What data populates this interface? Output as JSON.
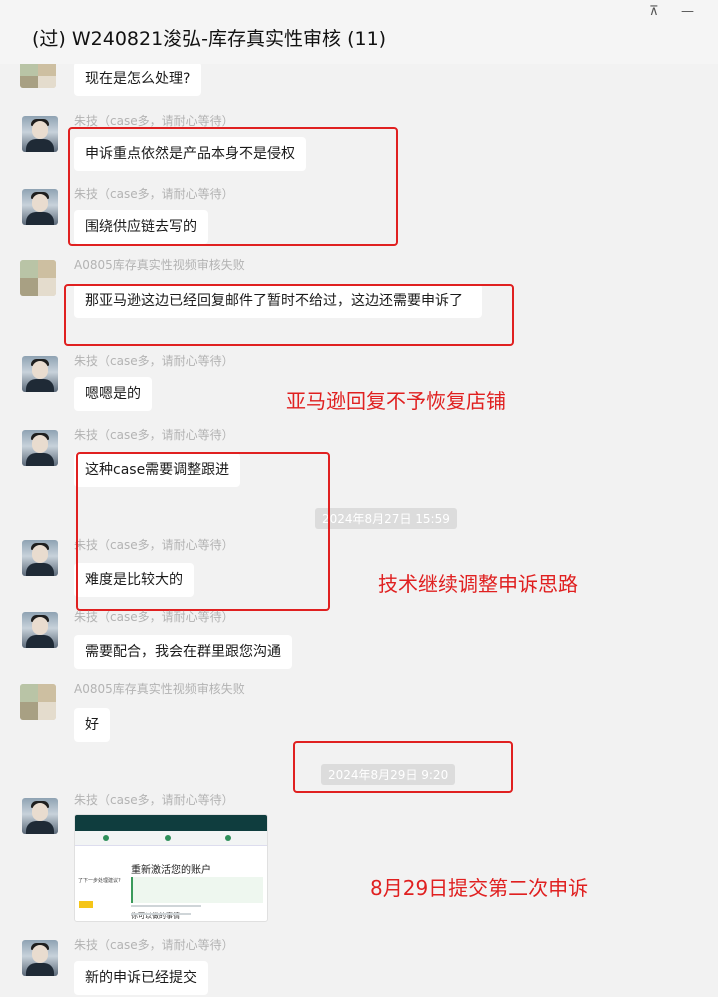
{
  "window": {
    "title": "(过) W240821浚弘-库存真实性审核 (11)",
    "pin_icon": "pin-icon",
    "minimize_icon": "minimize-icon"
  },
  "senders": {
    "tech": "朱技（case多，请耐心等待）",
    "customer": "A0805库存真实性视频审核失败"
  },
  "messages": {
    "m0": "现在是怎么处理?",
    "m1": "申诉重点依然是产品本身不是侵权",
    "m2": "围绕供应链去写的",
    "m3": "那亚马逊这边已经回复邮件了暂时不给过，这边还需要申诉了",
    "m4": "嗯嗯是的",
    "m5": "这种case需要调整跟进",
    "m6": "难度是比较大的",
    "m7": "需要配合，我会在群里跟您沟通",
    "m8": "好",
    "m9": "新的申诉已经提交"
  },
  "timestamps": {
    "t1": "2024年8月27日 15:59",
    "t2": "2024年8月29日 9:20"
  },
  "annotations": {
    "a1": "亚马逊回复不予恢复店铺",
    "a2": "技术继续调整申诉思路",
    "a3": "8月29日提交第二次申诉"
  },
  "screenshot_thumb": {
    "heading": "重新激活您的账户",
    "subheading": "你可以做的事情",
    "left_text": "了下一步处理建议?"
  },
  "colors": {
    "annotation_red": "#e02020",
    "background": "#f2f2f2",
    "bubble": "#ffffff",
    "sender_grey": "#b3b3b3"
  }
}
